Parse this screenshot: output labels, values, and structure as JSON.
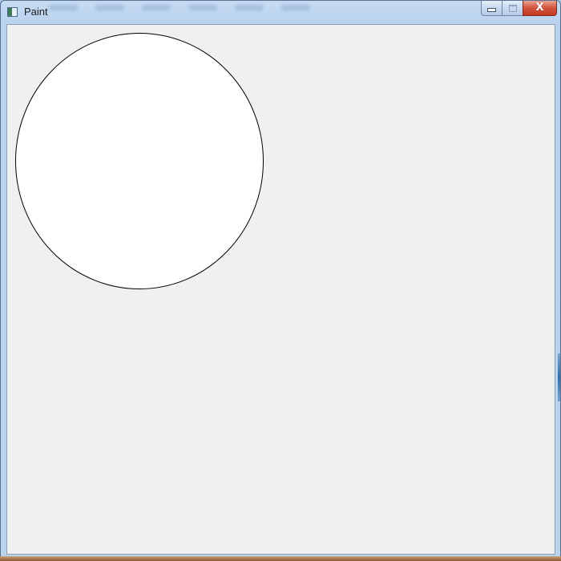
{
  "window": {
    "title": "Paint",
    "buttons": {
      "minimize_icon": "minimize-icon",
      "maximize_icon": "maximize-icon",
      "close_icon": "close-icon",
      "close_glyph": "X"
    }
  },
  "canvas": {
    "background_color": "#f0f0f0",
    "shape": {
      "type": "ellipse",
      "fill": "#ffffff",
      "stroke": "#000000"
    }
  },
  "colors": {
    "titlebar": "#b9d2ee",
    "close_button": "#c94a32",
    "taskbar_edge": "#8a5a33"
  }
}
